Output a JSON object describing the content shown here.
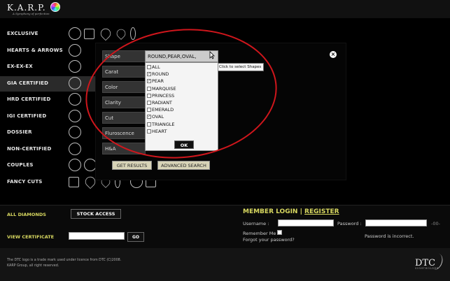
{
  "brand": {
    "logo_text": "K.A.R.P.",
    "tagline": "A Symphony of perfection"
  },
  "nav": [
    {
      "label": "EXCLUSIVE",
      "icons": [
        "round-icon",
        "square-icon",
        "heart-icon",
        "pear-icon",
        "marquise-icon"
      ]
    },
    {
      "label": "HEARTS & ARROWS",
      "icons": [
        "round-icon"
      ]
    },
    {
      "label": "EX-EX-EX",
      "icons": [
        "round-icon"
      ]
    },
    {
      "label": "GIA CERTIFIED",
      "icons": [
        "round-icon"
      ]
    },
    {
      "label": "HRD CERTIFIED",
      "icons": [
        "round-icon"
      ]
    },
    {
      "label": "IGI CERTIFIED",
      "icons": [
        "round-icon"
      ]
    },
    {
      "label": "DOSSIER",
      "icons": [
        "round-icon"
      ]
    },
    {
      "label": "NON-CERTIFIED",
      "icons": [
        "round-icon"
      ]
    },
    {
      "label": "COUPLES",
      "icons": [
        "round-icon",
        "round-icon"
      ]
    },
    {
      "label": "FANCY CUTS",
      "icons": [
        "square-icon",
        "heart-icon",
        "pear-icon",
        "marquise-icon",
        "oval-icon",
        "emerald-icon"
      ]
    }
  ],
  "active_nav": "GIA CERTIFIED",
  "search": {
    "criteria": [
      "Shape",
      "Carat",
      "Color",
      "Clarity",
      "Cut",
      "Fluroscence",
      "H&A"
    ],
    "shape_value": "ROUND,PEAR,OVAL,",
    "tooltip": "Click to select Shapes",
    "options": [
      {
        "label": "ALL",
        "checked": false
      },
      {
        "label": "ROUND",
        "checked": true
      },
      {
        "label": "PEAR",
        "checked": true
      },
      {
        "label": "MARQUISE",
        "checked": false
      },
      {
        "label": "PRINCESS",
        "checked": false
      },
      {
        "label": "RADIANT",
        "checked": false
      },
      {
        "label": "EMERALD",
        "checked": false
      },
      {
        "label": "OVAL",
        "checked": true
      },
      {
        "label": "TRIANGLE",
        "checked": false
      },
      {
        "label": "HEART",
        "checked": false
      }
    ],
    "ok_label": "OK",
    "close_label": "×",
    "get_results": "GET RESULTS",
    "advanced_search": "ADVANCED SEARCH"
  },
  "footer": {
    "all_diamonds": "ALL DIAMONDS",
    "stock_access": "STOCK ACCESS",
    "view_certificate": "VIEW CERTIFICATE",
    "go": "GO",
    "member_login": "MEMBER LOGIN",
    "separator": "|",
    "register": "REGISTER",
    "username_label": "Username :",
    "password_label": "Password :",
    "password_suffix": "-00-",
    "remember_me": "Remember Me",
    "forgot_password": "Forgot your password?",
    "error": "Password is incorrect.",
    "legal_line1": "The DTC logo is a trade mark used under licence from DTC (C)2008.",
    "legal_line2": "KARP Group, all right reserved.",
    "dtc_logo": "DTC",
    "dtc_sub": "SIGHTHOLDER"
  },
  "colors": {
    "accent_yellow": "#d8d860",
    "annotation_red": "#d0161c"
  }
}
